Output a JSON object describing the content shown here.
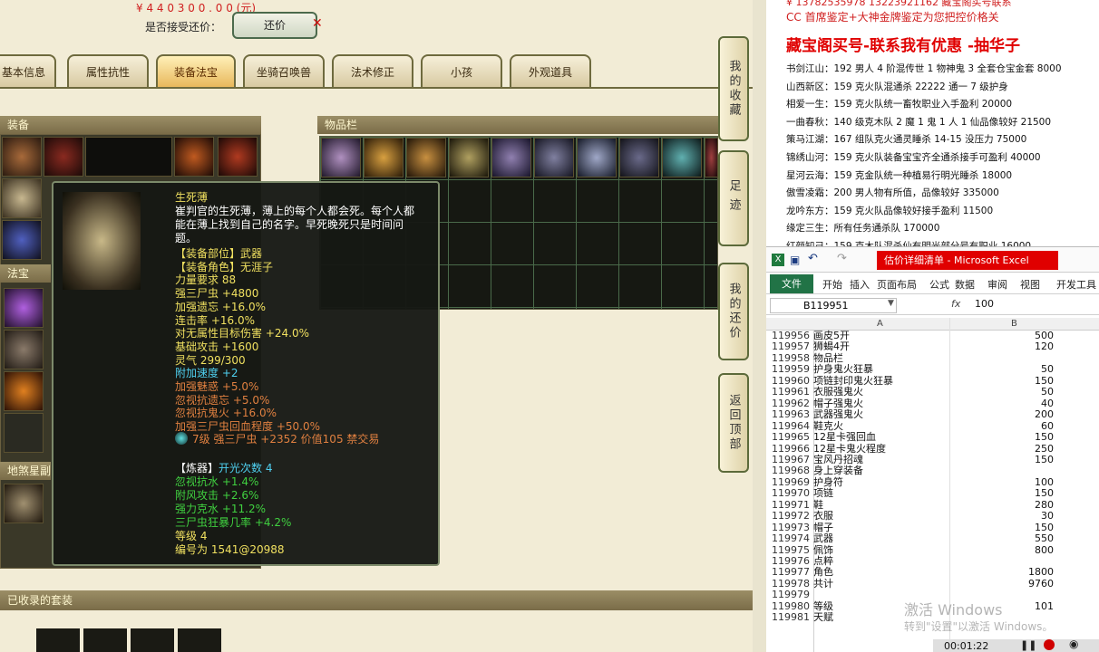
{
  "top": {
    "price_partial": "¥ 4 4 0 3 0 0 . 0 0 (元)",
    "accept_label": "是否接受还价：",
    "counter_btn": "还价"
  },
  "tabs": [
    "基本信息",
    "属性抗性",
    "装备法宝",
    "坐骑召唤兽",
    "法术修正",
    "小孩",
    "外观道具"
  ],
  "panels": {
    "equip": "装备",
    "items": "物品栏",
    "fabao": "法宝",
    "dishaxing": "地煞星副",
    "suits": "已收录的套装"
  },
  "side_buttons": [
    "我的收藏",
    "足迹",
    "我的还价",
    "返回顶部"
  ],
  "tooltip": {
    "name": "生死薄",
    "desc1": "崔判官的生死薄，薄上的每个人都会死。每个人都",
    "desc2": "能在薄上找到自己的名字。早死晚死只是时间问",
    "desc3": "题。",
    "lines": [
      {
        "t": "【装备部位】武器",
        "c": "#f0e060"
      },
      {
        "t": "【装备角色】无涯子",
        "c": "#f0e060"
      },
      {
        "t": "力量要求 88",
        "c": "#f0e060"
      },
      {
        "t": "强三尸虫 +4800",
        "c": "#f0e060"
      },
      {
        "t": "加强遗忘 +16.0%",
        "c": "#f0e060"
      },
      {
        "t": "连击率 +16.0%",
        "c": "#f0e060"
      },
      {
        "t": "对无属性目标伤害 +24.0%",
        "c": "#f0e060"
      },
      {
        "t": "基础攻击 +1600",
        "c": "#f0e060"
      },
      {
        "t": "灵气 299/300",
        "c": "#f0e060"
      },
      {
        "t": "附加速度 +2",
        "c": "#4fd0f0"
      },
      {
        "t": "加强魅惑 +5.0%",
        "c": "#e08040"
      },
      {
        "t": "忽视抗遗忘 +5.0%",
        "c": "#e08040"
      },
      {
        "t": "忽视抗鬼火 +16.0%",
        "c": "#e08040"
      },
      {
        "t": "加强三尸虫回血程度 +50.0%",
        "c": "#e08040"
      }
    ],
    "gem": "7级 强三尸虫 +2352 价值105 禁交易",
    "refine_head": "【炼器】",
    "refine_count": "开光次数 4",
    "refine": [
      "忽视抗水 +1.4%",
      "附风攻击 +2.6%",
      "强力克水 +11.2%",
      "三尸虫狂暴几率 +4.2%"
    ],
    "level": "等级 4",
    "serial": "编号为 1541@20988"
  },
  "ads": {
    "phone": "¥ 13782535978 13223921162 藏宝阁买号联系",
    "line2": "CC 首席鉴定+大神金牌鉴定为您把控价格关",
    "banner": "藏宝阁买号-联系我有优惠 -抽华子",
    "list": [
      "书剑江山：192 男人 4 阶混传世 1 物神鬼 3 全套仓宝金套 8000",
      "山西新区：159 克火队混通杀 22222 通一 7 级护身",
      "相爱一生：159 克火队统一畜牧职业入手盈利 20000",
      "一曲春秋：140 级克木队 2 魔 1 鬼 1 人 1 仙品像较好 21500",
      "策马江湖：167 组队克火通灵睡杀 14-15 没压力 75000",
      "锦绣山河：159 克火队装备宝宝齐全通杀接手可盈利 40000",
      "星河云海：159 克金队统一种植易行明光睡杀 18000",
      "傲雪凌霜：200 男人物有所值，品像较好 335000",
      "龙吟东方：159 克火队品像较好接手盈利 11500",
      "缘定三生：所有任务通杀队 170000",
      "红颜知己：159 克木队混杀仙有明光部分号有职业 16000"
    ]
  },
  "excel": {
    "title": "估价详细清单 - Microsoft Excel",
    "menu": [
      "文件",
      "开始",
      "插入",
      "页面布局",
      "公式",
      "数据",
      "审阅",
      "视图",
      "开发工具"
    ],
    "namebox": "B119951",
    "fx": "fx",
    "formula": "100",
    "col_a": "A",
    "col_b": "B",
    "rows": [
      [
        "119956",
        "画皮5开",
        "500"
      ],
      [
        "119957",
        "狮蝎4开",
        "120"
      ],
      [
        "119958",
        "物品栏",
        ""
      ],
      [
        "119959",
        "护身鬼火狂暴",
        "50"
      ],
      [
        "119960",
        "项链封印鬼火狂暴",
        "150"
      ],
      [
        "119961",
        "衣服强鬼火",
        "50"
      ],
      [
        "119962",
        "帽子强鬼火",
        "40"
      ],
      [
        "119963",
        "武器强鬼火",
        "200"
      ],
      [
        "119964",
        "鞋克火",
        "60"
      ],
      [
        "119965",
        "12星卡强回血",
        "150"
      ],
      [
        "119966",
        "12星卡鬼火程度",
        "250"
      ],
      [
        "119967",
        "宝风丹招魂",
        "150"
      ],
      [
        "119968",
        "身上穿装备",
        ""
      ],
      [
        "119969",
        "护身符",
        "100"
      ],
      [
        "119970",
        "项链",
        "150"
      ],
      [
        "119971",
        "鞋",
        "280"
      ],
      [
        "119972",
        "衣服",
        "30"
      ],
      [
        "119973",
        "帽子",
        "150"
      ],
      [
        "119974",
        "武器",
        "550"
      ],
      [
        "119975",
        "佩饰",
        "800"
      ],
      [
        "119976",
        "点粹",
        ""
      ],
      [
        "119977",
        "角色",
        "1800"
      ],
      [
        "119978",
        "共计",
        "9760"
      ],
      [
        "119979",
        "",
        ""
      ],
      [
        "119980",
        "等级",
        "101"
      ],
      [
        "119981",
        "天赋",
        ""
      ]
    ]
  },
  "watermark": {
    "l1": "激活 Windows",
    "l2": "转到\"设置\"以激活 Windows。"
  },
  "player": {
    "time": "00:01:22"
  },
  "colors": {
    "banner_red": "#e00000",
    "excel_green": "#217346",
    "tooltip_name": "#f0e060"
  }
}
